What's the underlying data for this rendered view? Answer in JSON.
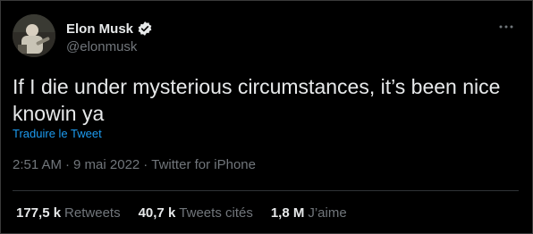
{
  "author": {
    "display_name": "Elon Musk",
    "handle": "@elonmusk"
  },
  "tweet": {
    "text": "If I die under mysterious circumstances, it’s been nice knowin ya",
    "translate_label": "Traduire le Tweet",
    "time": "2:51 AM",
    "date": "9 mai 2022",
    "source": "Twitter for iPhone",
    "separator": "·"
  },
  "stats": {
    "retweets": {
      "value": "177,5 k",
      "label": "Retweets"
    },
    "quotes": {
      "value": "40,7 k",
      "label": "Tweets cités"
    },
    "likes": {
      "value": "1,8 M",
      "label": "J’aime"
    }
  },
  "colors": {
    "background": "#000000",
    "text": "#e7e9ea",
    "muted": "#71767b",
    "link": "#1d9bf0",
    "verified_badge": "#e7e9ea"
  },
  "icons": {
    "verified": "verified-badge-icon",
    "more": "more-options-icon"
  }
}
